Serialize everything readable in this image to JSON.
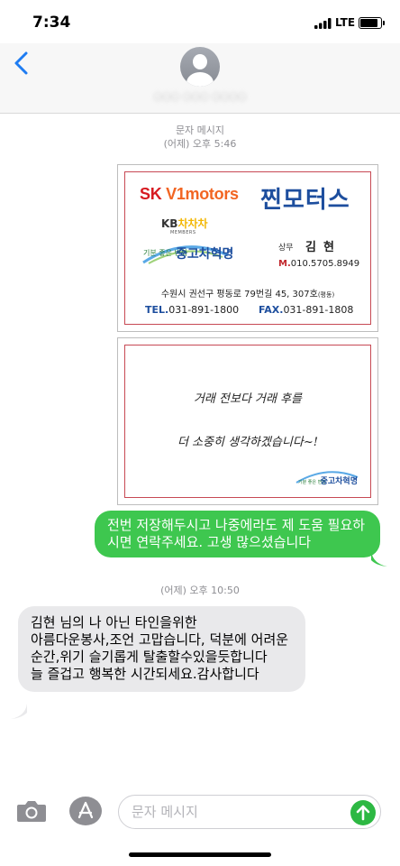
{
  "status_bar": {
    "time": "7:34",
    "network": "LTE"
  },
  "header": {
    "contact_name": "○○○ ○○○ ○○○○"
  },
  "thread": {
    "first_stamp": {
      "label": "문자 메시지",
      "time": "(어제) 오후 5:46"
    },
    "business_card": {
      "sk_brand": "SK",
      "sk_brand_rest": " V1motors",
      "jjin_brand": "찐모터스",
      "kb_logo_prefix": "KB",
      "kb_logo_suffix": "차차차",
      "kb_members": "MEMBERS",
      "revolution_slogan": "기분 좋은 변화",
      "revolution_name": "중고차혁명",
      "person_role": "상무",
      "person_name": "김현",
      "mobile_prefix": "M.",
      "mobile": "010.5705.8949",
      "address": "수원시 권선구 평동로 79번길 45, 307호",
      "address_note": "(평동)",
      "tel_label": "TEL.",
      "tel": "031-891-1800",
      "fax_label": "FAX.",
      "fax": "031-891-1808"
    },
    "card_back": {
      "line1": "거래 전보다 거래 후를",
      "line2": "더 소중히 생각하겠습니다~!",
      "logo_slogan": "기분 좋은 변화",
      "logo_name": "중고차혁명"
    },
    "sent_message": "전번 저장해두시고 나중에라도 제 도움 필요하시면 연락주세요. 고생 많으셨습니다",
    "second_stamp": "(어제) 오후 10:50",
    "received_message": "김현 님의 나 아닌 타인을위한\n아름다운봉사,조언 고맙습니다, 덕분에 어려운순간,위기 슬기롭게 탈출할수있을듯합니다\n늘 즐겁고 행복한 시간되세요.감사합니다"
  },
  "input_bar": {
    "placeholder": "문자 메시지"
  },
  "colors": {
    "sent_bubble": "#3ec74f",
    "received_bubble": "#e9e9eb",
    "accent_blue": "#1e7cf2",
    "send_button": "#2db843"
  }
}
